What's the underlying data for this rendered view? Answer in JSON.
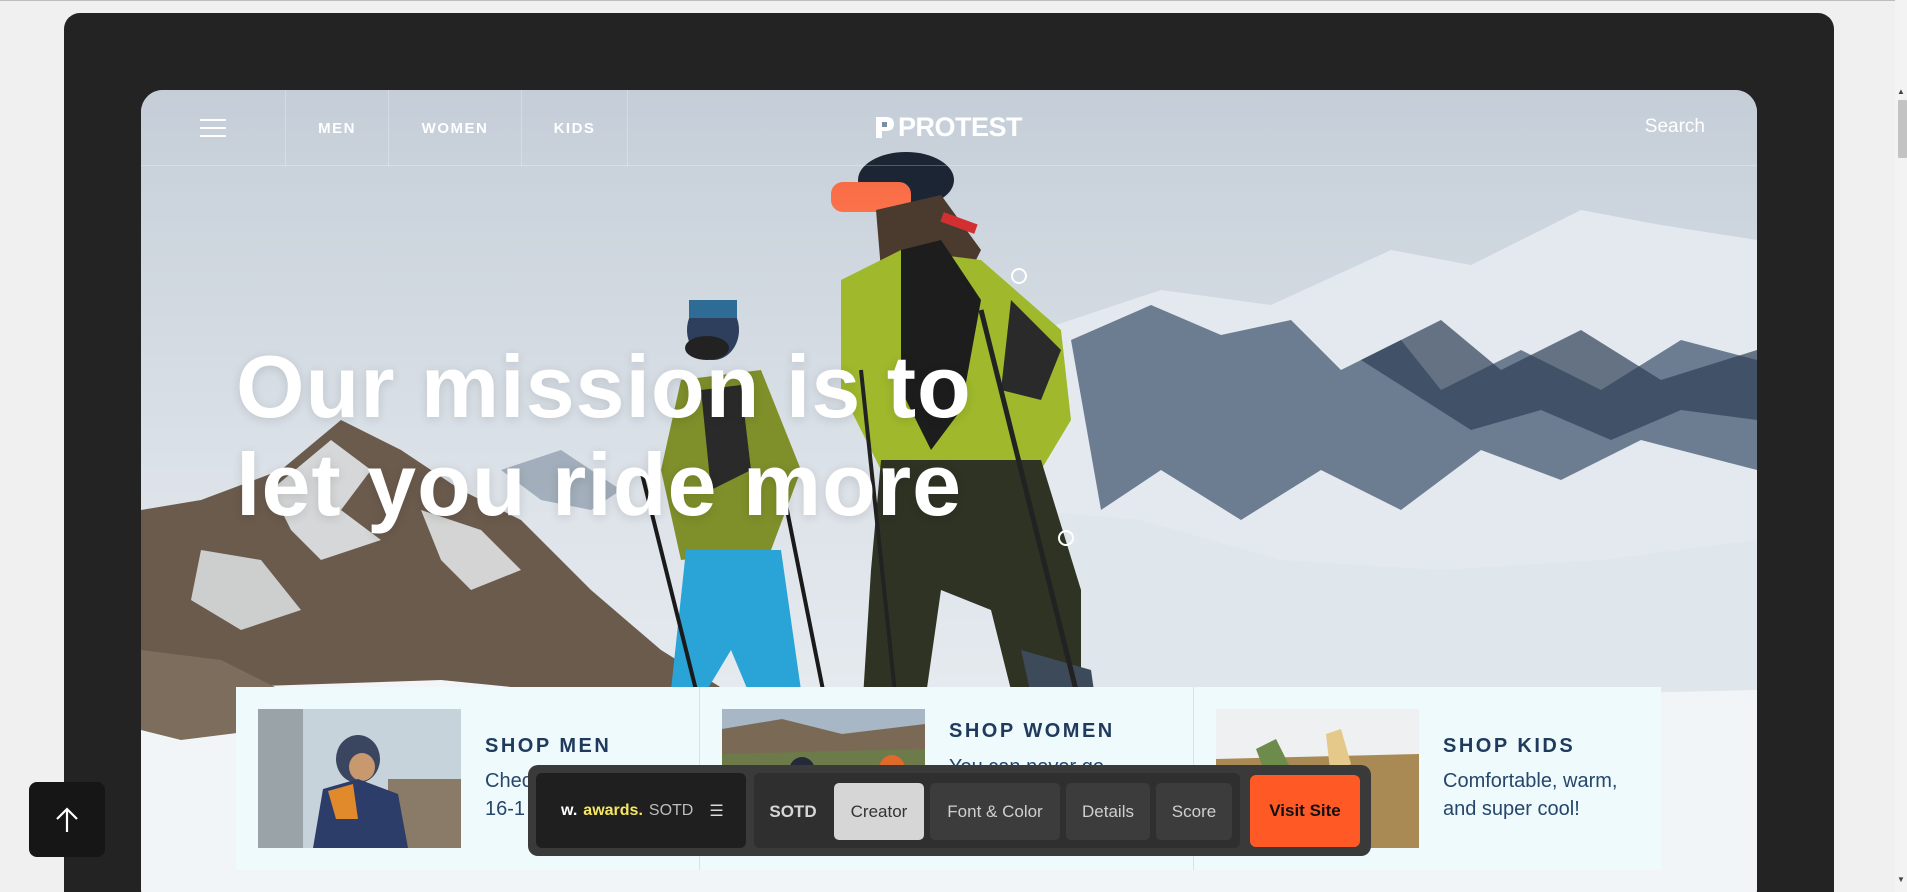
{
  "nav": {
    "men": "MEN",
    "women": "WOMEN",
    "kids": "KIDS",
    "logo": "PROTEST",
    "search": "Search"
  },
  "hero": {
    "headline_line1": "Our mission is to",
    "headline_line2": "let you ride more"
  },
  "shop": [
    {
      "title": "SHOP MEN",
      "text_line1": "Chec",
      "text_line2": "16-1"
    },
    {
      "title": "SHOP WOMEN",
      "text_line1": "You can never go"
    },
    {
      "title": "SHOP KIDS",
      "text_line1": "Comfortable, warm,",
      "text_line2": "and super cool!"
    }
  ],
  "awards_bar": {
    "brand_w": "w.",
    "brand_awards": "awards.",
    "brand_sotd": "SOTD",
    "tabs": [
      "SOTD",
      "Creator",
      "Font & Color",
      "Details",
      "Score"
    ],
    "active_tab": "Creator",
    "visit": "Visit Site"
  },
  "colors": {
    "frame": "#232323",
    "accent_orange": "#ff5a26",
    "awards_yellow": "#f5e663",
    "shop_title": "#1f3a5c",
    "shop_bg": "#eefafc"
  },
  "icons": {
    "menu": "hamburger-icon",
    "back_to_top": "arrow-up-icon",
    "awards_menu": "list-icon"
  }
}
